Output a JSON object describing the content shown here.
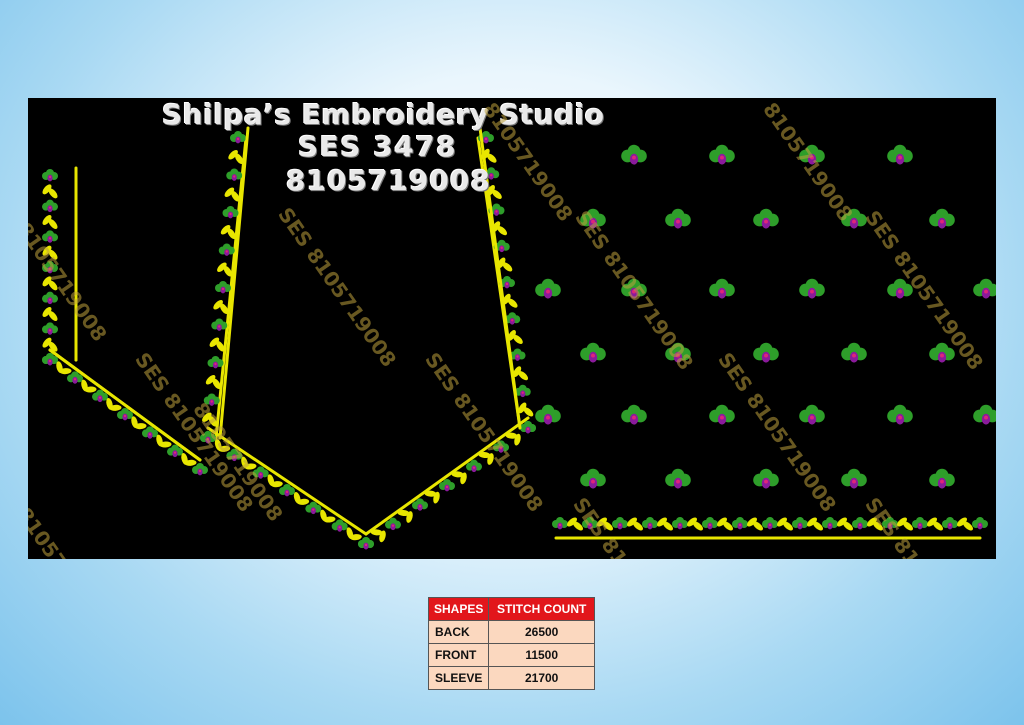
{
  "design": {
    "studio_name": "Shilpa’s Embroidery Studio",
    "design_code": "SES  3478",
    "phone": "8105719008",
    "watermark_text": "SES 8105719008",
    "watermark_alt": "8105719008",
    "colors": {
      "background": "#000000",
      "border_yellow": "#e8e600",
      "leaf_green": "#2e9e2a",
      "flower_purple": "#8a1a9b",
      "flower_pink": "#e0247a",
      "page_blue": "#7cc3ec"
    }
  },
  "table": {
    "headers": [
      "SHAPES",
      "STITCH COUNT"
    ],
    "rows": [
      {
        "shape": "BACK",
        "count": "26500"
      },
      {
        "shape": "FRONT",
        "count": "11500"
      },
      {
        "shape": "SLEEVE",
        "count": "21700"
      }
    ]
  }
}
